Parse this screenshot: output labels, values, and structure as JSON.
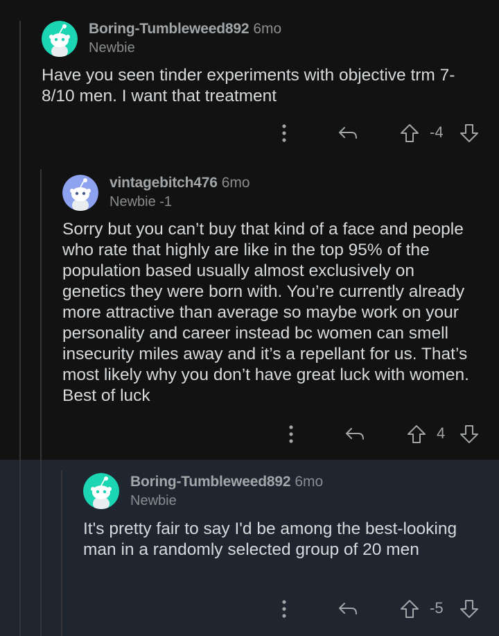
{
  "comments": [
    {
      "author": "Boring-Tumbleweed892",
      "age": "6mo",
      "flair": "Newbie",
      "body": "Have you seen tinder experiments with objective trm 7-8/10 men. I want that treatment",
      "score": "-4",
      "avatar_color": "#1bd5b3"
    },
    {
      "author": "vintagebitch476",
      "age": "6mo",
      "flair": "Newbie -1",
      "body": "Sorry but you can’t buy that kind of a face and people who rate that highly are like in the top 95% of the population based usually almost exclusively on genetics they were born with. You’re currently already more attractive than average so maybe work on your personality and career instead bc women can smell insecurity miles away and it’s a repellant for us. That’s most likely why you don’t have great luck with women. Best of luck",
      "score": "4",
      "avatar_color": "#8ea3f0"
    },
    {
      "author": "Boring-Tumbleweed892",
      "age": "6mo",
      "flair": "Newbie",
      "body": "It's pretty fair to say I'd be among the best-looking man in a randomly selected group of 20 men",
      "score": "-5",
      "avatar_color": "#1bd5b3"
    }
  ],
  "icons": {
    "more": "more-vertical-icon",
    "reply": "reply-icon",
    "upvote": "upvote-icon",
    "downvote": "downvote-icon"
  }
}
